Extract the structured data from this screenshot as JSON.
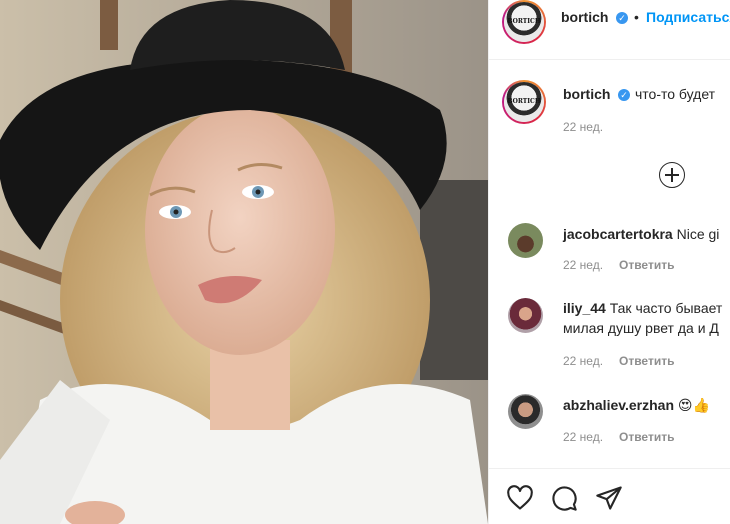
{
  "post": {
    "username": "bortich",
    "follow_label": "Подписаться",
    "caption_username": "bortich",
    "caption_text": "что-то будет",
    "caption_time": "22 нед."
  },
  "comments": [
    {
      "username": "jacobcartertokra",
      "text": "Nice gi",
      "time": "22 нед.",
      "reply": "Ответить"
    },
    {
      "username": "iliy_44",
      "text": "Так часто бывает",
      "text2": "милая душу рвет да и Д",
      "time": "22 нед.",
      "reply": "Ответить"
    },
    {
      "username": "abzhaliev.erzhan",
      "text": "😍👍",
      "time": "22 нед.",
      "reply": "Ответить"
    }
  ],
  "icons": {
    "like": "heart-icon",
    "comment": "comment-icon",
    "share": "share-icon",
    "load_more": "plus-circle-icon",
    "verified": "verified-badge-icon"
  },
  "colors": {
    "accent": "#0095f6",
    "verified": "#3897f0",
    "muted": "#8e8e8e",
    "text": "#262626"
  }
}
